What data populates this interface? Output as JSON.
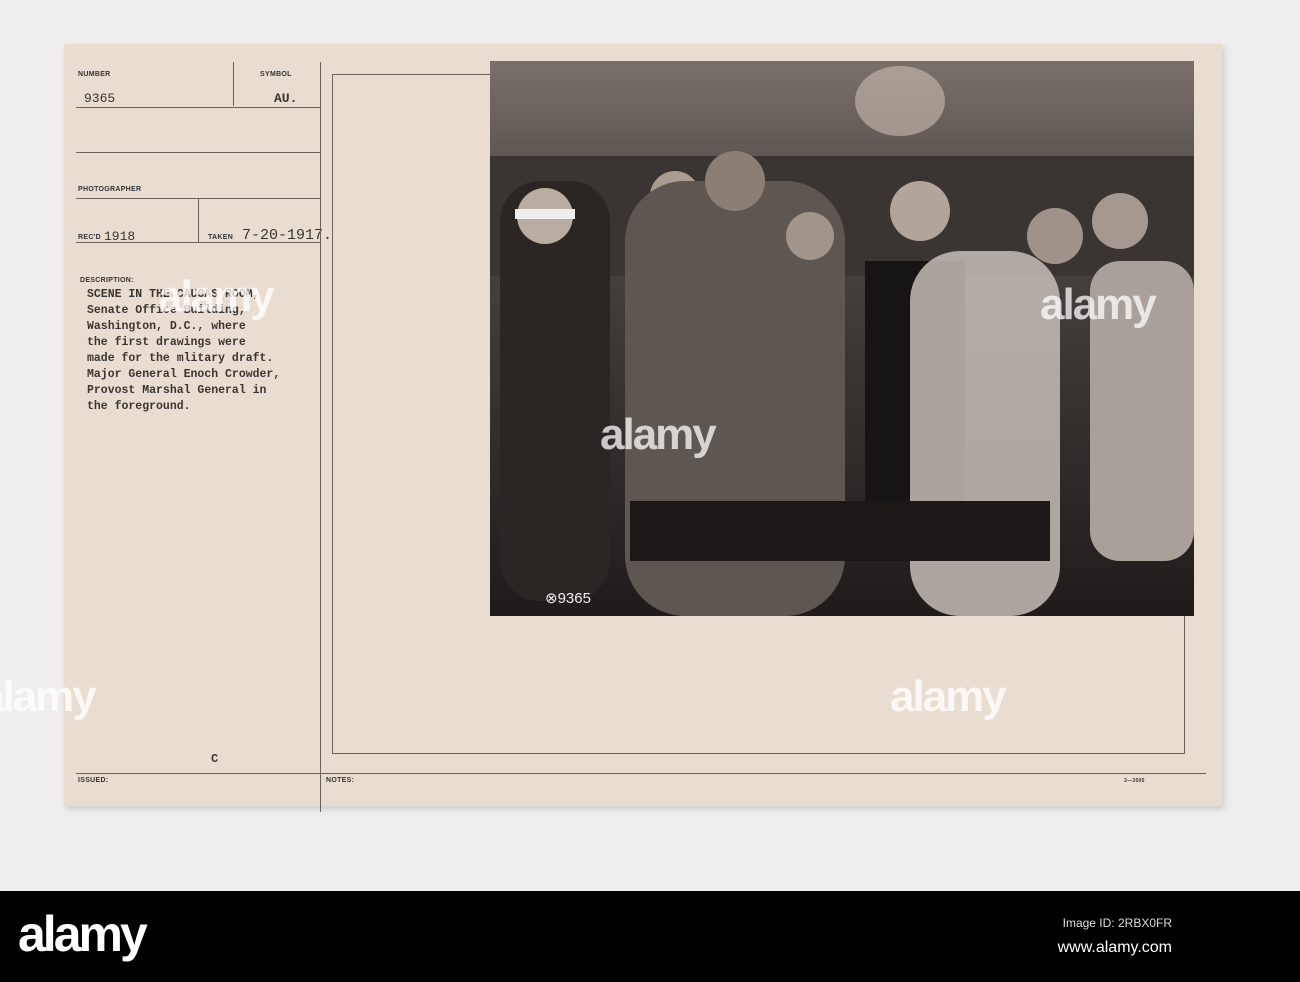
{
  "card": {
    "number_label": "NUMBER",
    "number": "9365",
    "symbol_label": "SYMBOL",
    "symbol": "AU.",
    "photographer_label": "PHOTOGRAPHER",
    "recd_label": "REC'D",
    "recd": "1918",
    "taken_label": "TAKEN",
    "taken": "7-20-1917.",
    "description_label": "DESCRIPTION:",
    "description": "SCENE IN THE CAUCAS ROOM,\nSenate Office Building,\nWashington, D.C., where\nthe first drawings were\nmade for the mlitary draft.\nMajor General Enoch Crowder,\nProvost Marshal General in\nthe foreground.",
    "issued_label": "ISSUED:",
    "issued_mark": "C",
    "notes_label": "NOTES:",
    "form_number": "3—3505",
    "photo_caption": "⊗9365"
  },
  "watermark": "alamy",
  "footer": {
    "logo": "alamy",
    "image_id": "Image ID: 2RBX0FR",
    "url": "www.alamy.com"
  }
}
